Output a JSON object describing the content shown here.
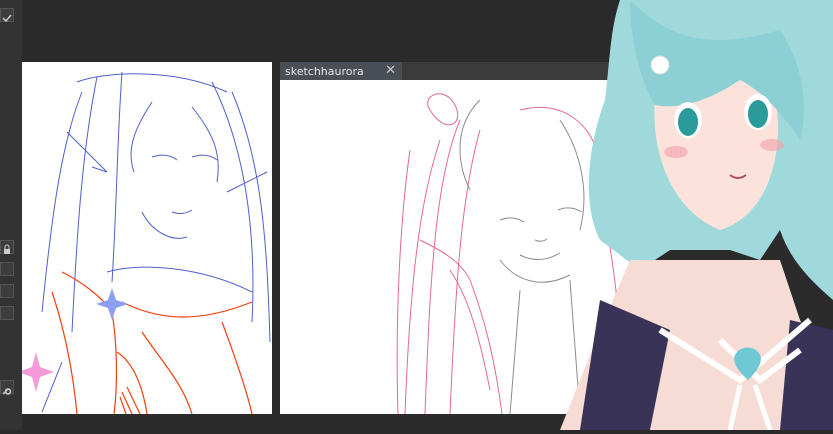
{
  "document_tab": {
    "title": "sketchhaurora"
  },
  "icons": {
    "close": "close-icon",
    "lock": "lock-icon",
    "wrench": "wrench-icon",
    "check": "check-icon"
  },
  "colors": {
    "ui_dark": "#2b2b2b",
    "tab_bg": "#4a4f56",
    "sketch_blue": "#3a4fc8",
    "sketch_red": "#f2400f",
    "sketch_pink": "#e0507a",
    "avatar_hair": "#8fd3d8"
  }
}
